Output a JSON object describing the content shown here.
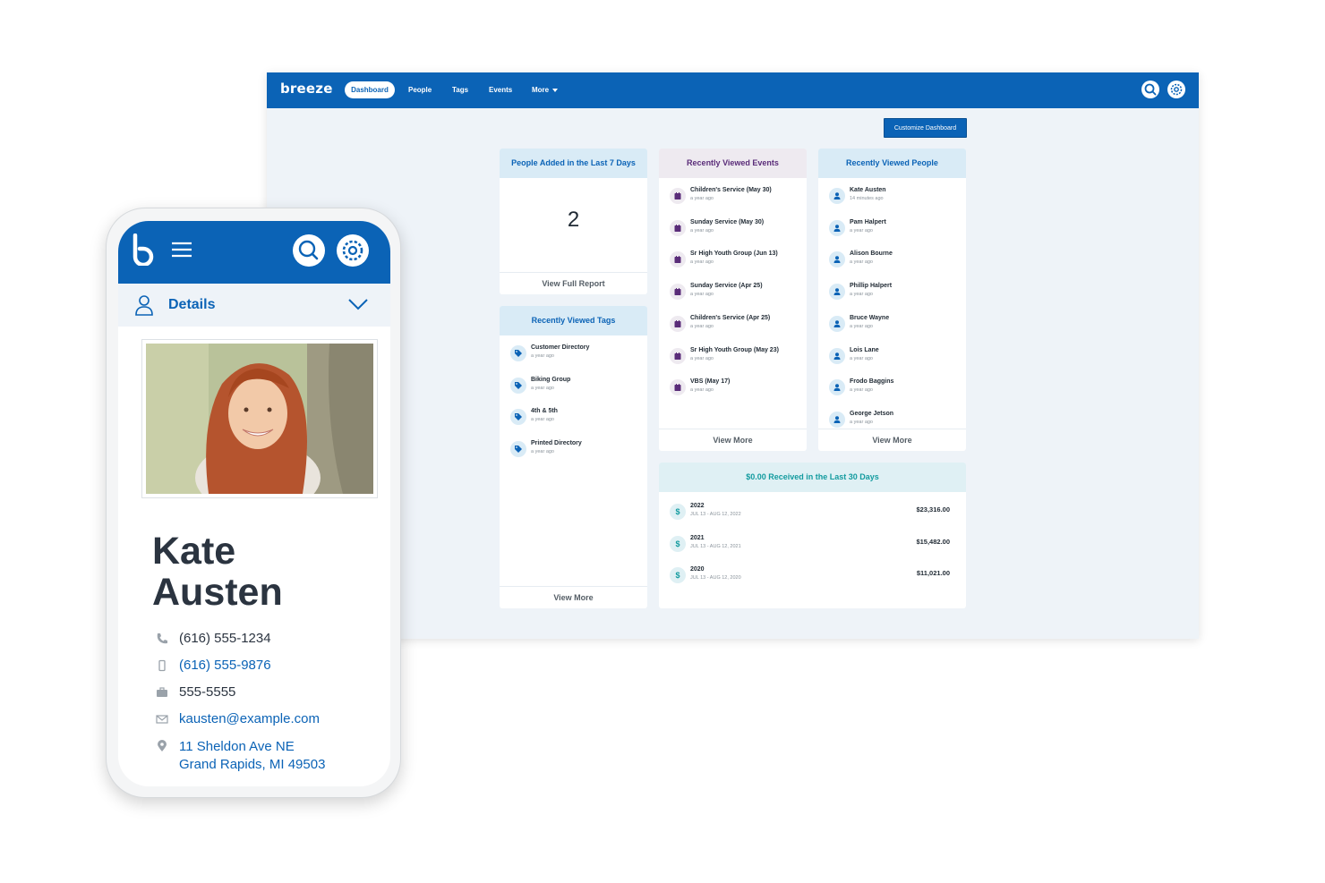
{
  "desktop": {
    "logo": "breeze",
    "nav": {
      "dashboard": "Dashboard",
      "people": "People",
      "tags": "Tags",
      "events": "Events",
      "more": "More"
    },
    "customize_label": "Customize Dashboard",
    "people_added": {
      "title": "People Added in the Last 7 Days",
      "count": "2",
      "footer": "View Full Report"
    },
    "recent_tags": {
      "title": "Recently Viewed Tags",
      "items": [
        {
          "name": "Customer Directory",
          "time": "a year ago"
        },
        {
          "name": "Biking Group",
          "time": "a year ago"
        },
        {
          "name": "4th & 5th",
          "time": "a year ago"
        },
        {
          "name": "Printed Directory",
          "time": "a year ago"
        }
      ],
      "footer": "View More"
    },
    "recent_events": {
      "title": "Recently Viewed Events",
      "items": [
        {
          "name": "Children's Service (May 30)",
          "time": "a year ago"
        },
        {
          "name": "Sunday Service (May 30)",
          "time": "a year ago"
        },
        {
          "name": "Sr High Youth Group (Jun 13)",
          "time": "a year ago"
        },
        {
          "name": "Sunday Service (Apr 25)",
          "time": "a year ago"
        },
        {
          "name": "Children's Service (Apr 25)",
          "time": "a year ago"
        },
        {
          "name": "Sr High Youth Group (May 23)",
          "time": "a year ago"
        },
        {
          "name": "VBS (May 17)",
          "time": "a year ago"
        }
      ],
      "footer": "View More"
    },
    "recent_people": {
      "title": "Recently Viewed People",
      "items": [
        {
          "name": "Kate Austen",
          "time": "14 minutes ago"
        },
        {
          "name": "Pam Halpert",
          "time": "a year ago"
        },
        {
          "name": "Alison Bourne",
          "time": "a year ago"
        },
        {
          "name": "Phillip Halpert",
          "time": "a year ago"
        },
        {
          "name": "Bruce Wayne",
          "time": "a year ago"
        },
        {
          "name": "Lois Lane",
          "time": "a year ago"
        },
        {
          "name": "Frodo Baggins",
          "time": "a year ago"
        },
        {
          "name": "George Jetson",
          "time": "a year ago"
        }
      ],
      "footer": "View More"
    },
    "received": {
      "title": "$0.00 Received in the Last 30 Days",
      "items": [
        {
          "year": "2022",
          "range": "JUL 13 - AUG 12, 2022",
          "amount": "$23,316.00"
        },
        {
          "year": "2021",
          "range": "JUL 13 - AUG 12, 2021",
          "amount": "$15,482.00"
        },
        {
          "year": "2020",
          "range": "JUL 13 - AUG 12, 2020",
          "amount": "$11,021.00"
        }
      ]
    }
  },
  "mobile": {
    "section_label": "Details",
    "first_name": "Kate",
    "last_name": "Austen",
    "home_phone": "(616) 555-1234",
    "mobile_phone": "(616) 555-9876",
    "work_phone": "555-5555",
    "email": "kausten@example.com",
    "address_line1": "11 Sheldon Ave NE",
    "address_line2": "Grand Rapids, MI 49503"
  },
  "colors": {
    "brand_blue": "#0b63b6",
    "event_purple": "#5a2c79",
    "money_teal": "#139b9f"
  },
  "icons": [
    "search-icon",
    "gear-icon",
    "menu-icon",
    "person-icon",
    "chevron-down-icon",
    "tag-icon",
    "calendar-icon",
    "dollar-icon",
    "phone-icon",
    "mobile-icon",
    "briefcase-icon",
    "mail-icon",
    "location-pin-icon"
  ]
}
